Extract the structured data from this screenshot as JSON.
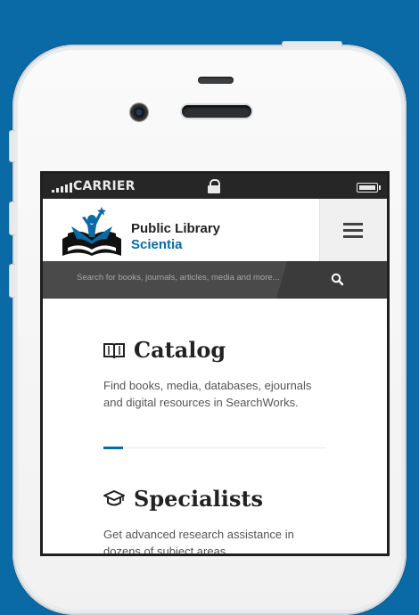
{
  "status": {
    "carrier": "CARRIER"
  },
  "brand": {
    "line1": "Public Library",
    "line2": "Scientia"
  },
  "search": {
    "placeholder": "Search for books, journals, articles, media and more..."
  },
  "sections": [
    {
      "title": "Catalog",
      "icon": "book-icon",
      "description": "Find books, media, databases, ejournals and digital resources in SearchWorks."
    },
    {
      "title": "Specialists",
      "icon": "graduation-cap-icon",
      "description": "Get advanced research assistance in dozens of subject areas."
    }
  ],
  "colors": {
    "background": "#0a6aa5",
    "accent": "#0a6aa5",
    "statusbar": "#262626",
    "searchbar": "#3b3b3b"
  }
}
